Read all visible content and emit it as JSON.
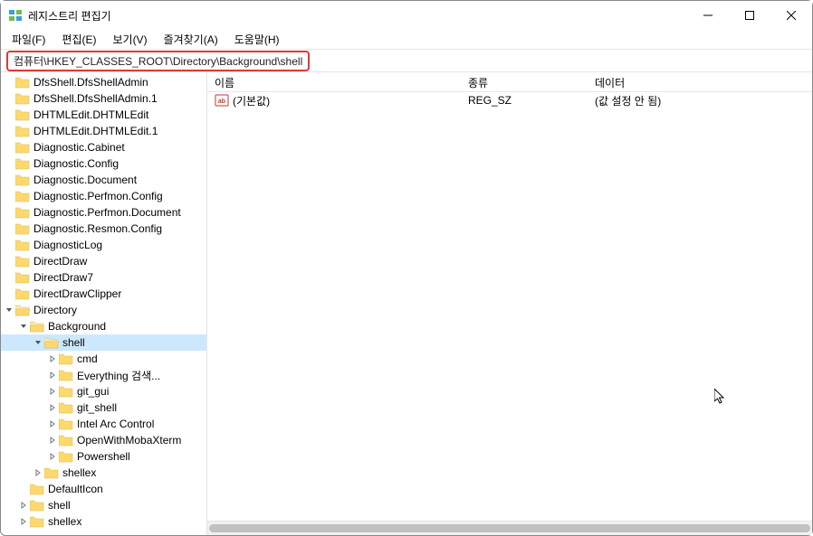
{
  "window": {
    "title": "레지스트리 편집기"
  },
  "menu": {
    "file": "파일(F)",
    "edit": "편집(E)",
    "view": "보기(V)",
    "favorites": "즐겨찾기(A)",
    "help": "도움말(H)"
  },
  "address": {
    "path": "컴퓨터\\HKEY_CLASSES_ROOT\\Directory\\Background\\shell"
  },
  "tree": [
    {
      "label": "DfsShell.DfsShellAdmin",
      "indent": 0,
      "twisty": "none"
    },
    {
      "label": "DfsShell.DfsShellAdmin.1",
      "indent": 0,
      "twisty": "none"
    },
    {
      "label": "DHTMLEdit.DHTMLEdit",
      "indent": 0,
      "twisty": "none"
    },
    {
      "label": "DHTMLEdit.DHTMLEdit.1",
      "indent": 0,
      "twisty": "none"
    },
    {
      "label": "Diagnostic.Cabinet",
      "indent": 0,
      "twisty": "none"
    },
    {
      "label": "Diagnostic.Config",
      "indent": 0,
      "twisty": "none"
    },
    {
      "label": "Diagnostic.Document",
      "indent": 0,
      "twisty": "none"
    },
    {
      "label": "Diagnostic.Perfmon.Config",
      "indent": 0,
      "twisty": "none"
    },
    {
      "label": "Diagnostic.Perfmon.Document",
      "indent": 0,
      "twisty": "none"
    },
    {
      "label": "Diagnostic.Resmon.Config",
      "indent": 0,
      "twisty": "none"
    },
    {
      "label": "DiagnosticLog",
      "indent": 0,
      "twisty": "none"
    },
    {
      "label": "DirectDraw",
      "indent": 0,
      "twisty": "none"
    },
    {
      "label": "DirectDraw7",
      "indent": 0,
      "twisty": "none"
    },
    {
      "label": "DirectDrawClipper",
      "indent": 0,
      "twisty": "none"
    },
    {
      "label": "Directory",
      "indent": 0,
      "twisty": "open"
    },
    {
      "label": "Background",
      "indent": 1,
      "twisty": "open"
    },
    {
      "label": "shell",
      "indent": 2,
      "twisty": "open",
      "selected": true
    },
    {
      "label": "cmd",
      "indent": 3,
      "twisty": "closed"
    },
    {
      "label": "Everything 검색...",
      "indent": 3,
      "twisty": "closed"
    },
    {
      "label": "git_gui",
      "indent": 3,
      "twisty": "closed"
    },
    {
      "label": "git_shell",
      "indent": 3,
      "twisty": "closed"
    },
    {
      "label": "Intel Arc Control",
      "indent": 3,
      "twisty": "closed"
    },
    {
      "label": "OpenWithMobaXterm",
      "indent": 3,
      "twisty": "closed"
    },
    {
      "label": "Powershell",
      "indent": 3,
      "twisty": "closed"
    },
    {
      "label": "shellex",
      "indent": 2,
      "twisty": "closed"
    },
    {
      "label": "DefaultIcon",
      "indent": 1,
      "twisty": "none"
    },
    {
      "label": "shell",
      "indent": 1,
      "twisty": "closed"
    },
    {
      "label": "shellex",
      "indent": 1,
      "twisty": "closed"
    }
  ],
  "list": {
    "headers": {
      "name": "이름",
      "type": "종류",
      "data": "데이터"
    },
    "rows": [
      {
        "name": "(기본값)",
        "type": "REG_SZ",
        "data": "(값 설정 안 됨)"
      }
    ]
  }
}
